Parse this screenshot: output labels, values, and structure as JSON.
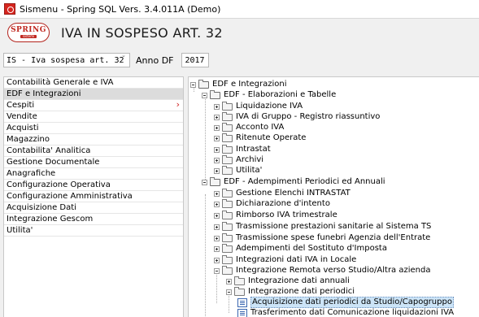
{
  "window": {
    "title": "Sismenu - Spring SQL Vers. 3.4.011A (Demo)"
  },
  "header": {
    "logo_text": "SPRING",
    "logo_subtext": "sistemi",
    "title": "IVA IN SOSPESO ART. 32"
  },
  "filters": {
    "selected_option": "IS - Iva sospesa art. 32",
    "year_label": "Anno DF",
    "year_value": "2017"
  },
  "sidebar": {
    "items": [
      {
        "label": "Contabilità Generale e IVA"
      },
      {
        "label": "EDF e Integrazioni"
      },
      {
        "label": "Cespiti"
      },
      {
        "label": "Vendite"
      },
      {
        "label": "Acquisti"
      },
      {
        "label": "Magazzino"
      },
      {
        "label": "Contabilita' Analitica"
      },
      {
        "label": "Gestione Documentale"
      },
      {
        "label": "Anagrafiche"
      },
      {
        "label": "Configurazione Operativa"
      },
      {
        "label": "Configurazione Amministrativa"
      },
      {
        "label": "Acquisizione Dati"
      },
      {
        "label": "Integrazione Gescom"
      },
      {
        "label": "Utilita'"
      }
    ],
    "selected_index": 1
  },
  "tree": {
    "nodes": [
      {
        "label": "EDF e Integrazioni"
      },
      {
        "label": "EDF - Elaborazioni e Tabelle"
      },
      {
        "label": "Liquidazione IVA"
      },
      {
        "label": "IVA di Gruppo - Registro riassuntivo"
      },
      {
        "label": "Acconto IVA"
      },
      {
        "label": "Ritenute Operate"
      },
      {
        "label": "Intrastat"
      },
      {
        "label": "Archivi"
      },
      {
        "label": "Utilita'"
      },
      {
        "label": "EDF - Adempimenti Periodici ed Annuali"
      },
      {
        "label": "Gestione Elenchi INTRASTAT"
      },
      {
        "label": "Dichiarazione d'intento"
      },
      {
        "label": "Rimborso IVA trimestrale"
      },
      {
        "label": "Trasmissione prestazioni sanitarie al Sistema TS"
      },
      {
        "label": "Trasmissione spese funebri Agenzia dell'Entrate"
      },
      {
        "label": "Adempimenti del Sostituto d'Imposta"
      },
      {
        "label": "Integrazioni dati IVA in Locale"
      },
      {
        "label": "Integrazione Remota verso Studio/Altra azienda"
      },
      {
        "label": "Integrazione dati annuali"
      },
      {
        "label": "Integrazione dati periodici"
      },
      {
        "label": "Acquisizione dati periodici da Studio/Capogruppo"
      },
      {
        "label": "Trasferimento dati Comunicazione liquidazioni IVA"
      }
    ]
  }
}
